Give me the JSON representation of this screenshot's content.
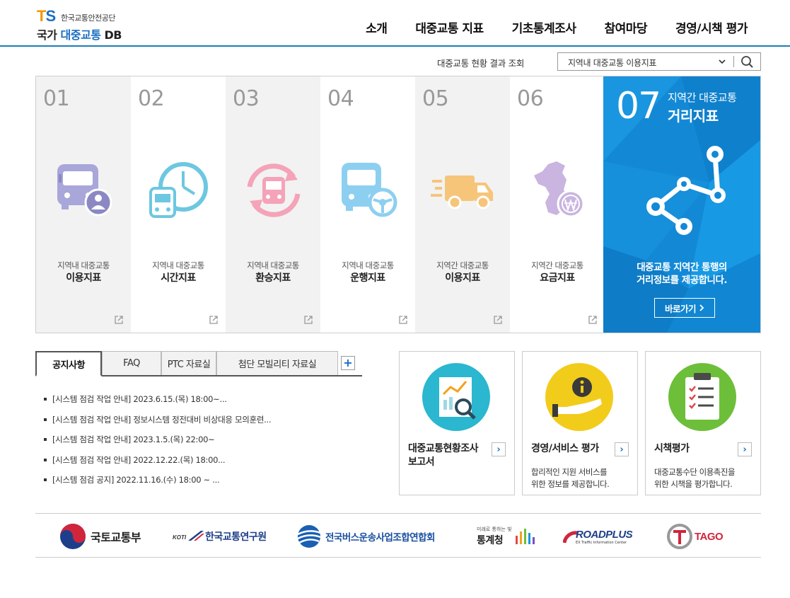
{
  "header": {
    "logo": {
      "mark": "TS",
      "org": "한국교통안전공단",
      "title_part1": "국가",
      "title_part2": "대중교통",
      "title_part3": "DB"
    },
    "nav": [
      "소개",
      "대중교통 지표",
      "기초통계조사",
      "참여마당",
      "경영/시책 평가"
    ]
  },
  "search": {
    "label": "대중교통 현황 결과 조회",
    "selected": "지역내 대중교통 이용지표"
  },
  "panels": [
    {
      "num": "01",
      "sub": "지역내 대중교통",
      "title": "이용지표",
      "icon": "bus-user-icon",
      "color": "#a9a6da"
    },
    {
      "num": "02",
      "sub": "지역내 대중교통",
      "title": "시간지표",
      "icon": "bus-clock-icon",
      "color": "#6cc8e0"
    },
    {
      "num": "03",
      "sub": "지역내 대중교통",
      "title": "환승지표",
      "icon": "bus-transfer-icon",
      "color": "#f4a3b8"
    },
    {
      "num": "04",
      "sub": "지역내 대중교통",
      "title": "운행지표",
      "icon": "bus-wheel-icon",
      "color": "#8dcff0"
    },
    {
      "num": "05",
      "sub": "지역간 대중교통",
      "title": "이용지표",
      "icon": "truck-icon",
      "color": "#f6c57a"
    },
    {
      "num": "06",
      "sub": "지역간 대중교통",
      "title": "요금지표",
      "icon": "korea-map-won-icon",
      "color": "#c9b5e0"
    }
  ],
  "feature": {
    "num": "07",
    "title1": "지역간 대중교통",
    "title2": "거리지표",
    "desc1": "대중교통 지역간 통행의",
    "desc2": "거리정보를 제공합니다.",
    "button": "바로가기",
    "icon": "share-network-icon"
  },
  "notice": {
    "tabs": [
      "공지사항",
      "FAQ",
      "PTC 자료실",
      "첨단 모빌리티 자료실"
    ],
    "active_tab": "공지사항",
    "more": "+",
    "items": [
      "[시스템 점검 작업 안내] 2023.6.15.(목) 18:00~...",
      "[시스템 점검 작업 안내] 정보시스템 정전대비 비상대응 모의훈련...",
      "[시스템 점검 작업 안내] 2023.1.5.(목) 22:00~",
      "[시스템 점검 작업 안내] 2022.12.22.(목) 18:00...",
      "[시스템 점검 공지] 2022.11.16.(수) 18:00 ~ ..."
    ]
  },
  "cards": [
    {
      "title1": "대중교통현황조사",
      "title2": "보고서",
      "desc1": "",
      "desc2": "",
      "icon": "report-chart-magnifier-icon",
      "color": "#2ab7cf"
    },
    {
      "title1": "경영/서비스 평가",
      "title2": "",
      "desc1": "합리적인 지원 서비스를",
      "desc2": "위한 정보를 제공합니다.",
      "icon": "hand-info-icon",
      "color": "#f2cc1b"
    },
    {
      "title1": "시책평가",
      "title2": "",
      "desc1": "대중교통수단 이용촉진을",
      "desc2": "위한 시책을 평가합니다.",
      "icon": "clipboard-checklist-icon",
      "color": "#6dbf3a"
    }
  ],
  "footer_logos": [
    {
      "name": "국토교통부",
      "icon": "molit-logo-icon"
    },
    {
      "name": "한국교통연구원",
      "icon": "koti-logo-icon"
    },
    {
      "name": "전국버스운송사업조합연합회",
      "icon": "bus-association-logo-icon"
    },
    {
      "name": "통계청",
      "tagline": "미래로 통하는 빛",
      "icon": "kostat-logo-icon"
    },
    {
      "name": "ROADPLUS",
      "tagline": "EX Traffic Information Center",
      "icon": "roadplus-logo-icon"
    },
    {
      "name": "TAGO",
      "icon": "tago-logo-icon"
    }
  ]
}
